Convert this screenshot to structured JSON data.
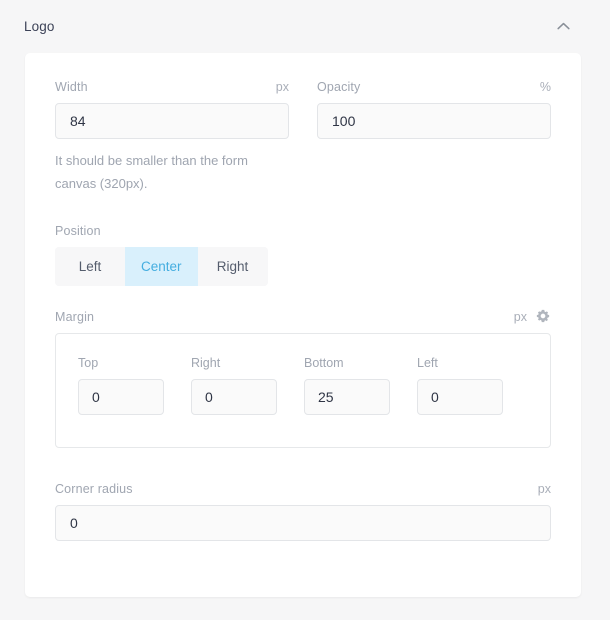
{
  "header": {
    "title": "Logo",
    "collapse_icon": "chevron-up-icon"
  },
  "fields": {
    "width": {
      "label": "Width",
      "unit": "px",
      "value": "84",
      "placeholder": "",
      "help": "It should be smaller than the form canvas (320px)."
    },
    "opacity": {
      "label": "Opacity",
      "unit": "%",
      "value": "100",
      "placeholder": ""
    },
    "position": {
      "label": "Position",
      "options": [
        "Left",
        "Center",
        "Right"
      ],
      "selected": "Center",
      "selected_bg": "#d9f0fc",
      "selected_fg": "#45aee0"
    },
    "margin": {
      "label": "Margin",
      "unit": "px",
      "settings_icon": "gear-icon",
      "sides": [
        {
          "label": "Top",
          "value": "0"
        },
        {
          "label": "Right",
          "value": "0"
        },
        {
          "label": "Bottom",
          "value": "25"
        },
        {
          "label": "Left",
          "value": "0"
        }
      ]
    },
    "corner_radius": {
      "label": "Corner radius",
      "unit": "px",
      "value": "0",
      "placeholder": ""
    }
  },
  "theme": {
    "page_bg": "#f6f6f7",
    "card_bg": "#ffffff",
    "label_color": "#a0a6b1",
    "input_bg": "#fafafa",
    "input_border": "#e3e5e8",
    "accent": "#45aee0"
  }
}
